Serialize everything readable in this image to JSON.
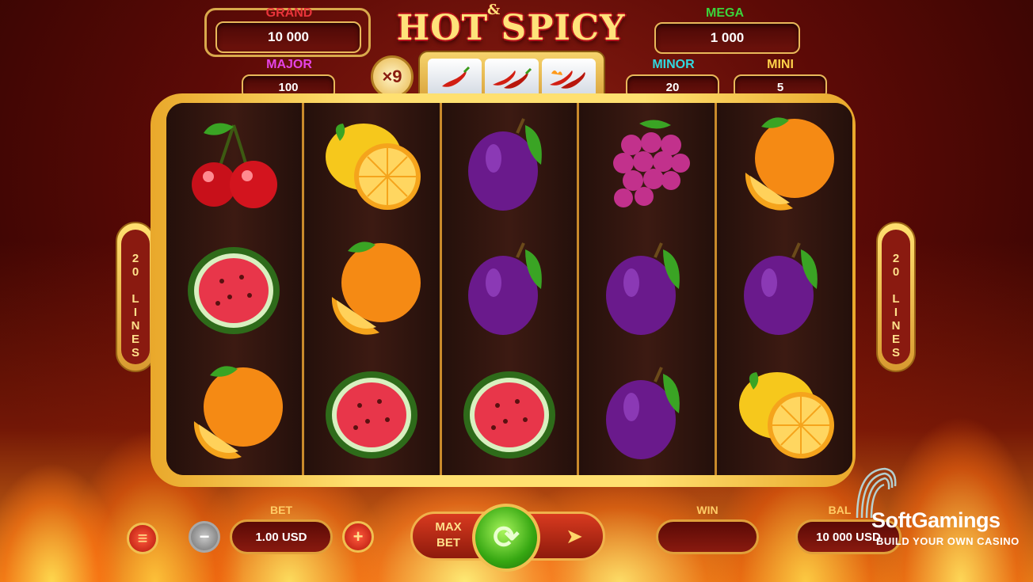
{
  "game": {
    "title": "HOT SPICY",
    "title_amp": "&",
    "multiplier": "×9"
  },
  "jackpots": {
    "grand": {
      "label": "GRAND",
      "value": "10 000",
      "color": "#e8343a"
    },
    "mega": {
      "label": "MEGA",
      "value": "1 000",
      "color": "#3bd43b"
    },
    "major": {
      "label": "MAJOR",
      "value": "100",
      "color": "#e543e6"
    },
    "minor": {
      "label": "MINOR",
      "value": "20",
      "color": "#30d8e0"
    },
    "mini": {
      "label": "MINI",
      "value": "5",
      "color": "#ffd24a"
    }
  },
  "mini_reels": [
    "chili",
    "double-chili",
    "fire-chili"
  ],
  "reels": [
    [
      "cherry",
      "watermelon",
      "orange"
    ],
    [
      "lemon",
      "orange",
      "watermelon"
    ],
    [
      "plum",
      "plum",
      "watermelon"
    ],
    [
      "grapes",
      "plum",
      "plum"
    ],
    [
      "orange",
      "plum",
      "lemon"
    ]
  ],
  "lines": {
    "left": "20 LINES",
    "right": "20 LINES"
  },
  "controls": {
    "bet_label": "BET",
    "bet_value": "1.00 USD",
    "win_label": "WIN",
    "win_value": "",
    "balance_label": "BAL",
    "balance_value": "10 000 USD",
    "max_bet_label": "MAX BET",
    "menu_icon": "menu-icon",
    "minus_icon": "minus-icon",
    "plus_icon": "plus-icon"
  },
  "brand": {
    "name": "SoftGamings",
    "tagline": "BUILD YOUR OWN CASINO"
  }
}
